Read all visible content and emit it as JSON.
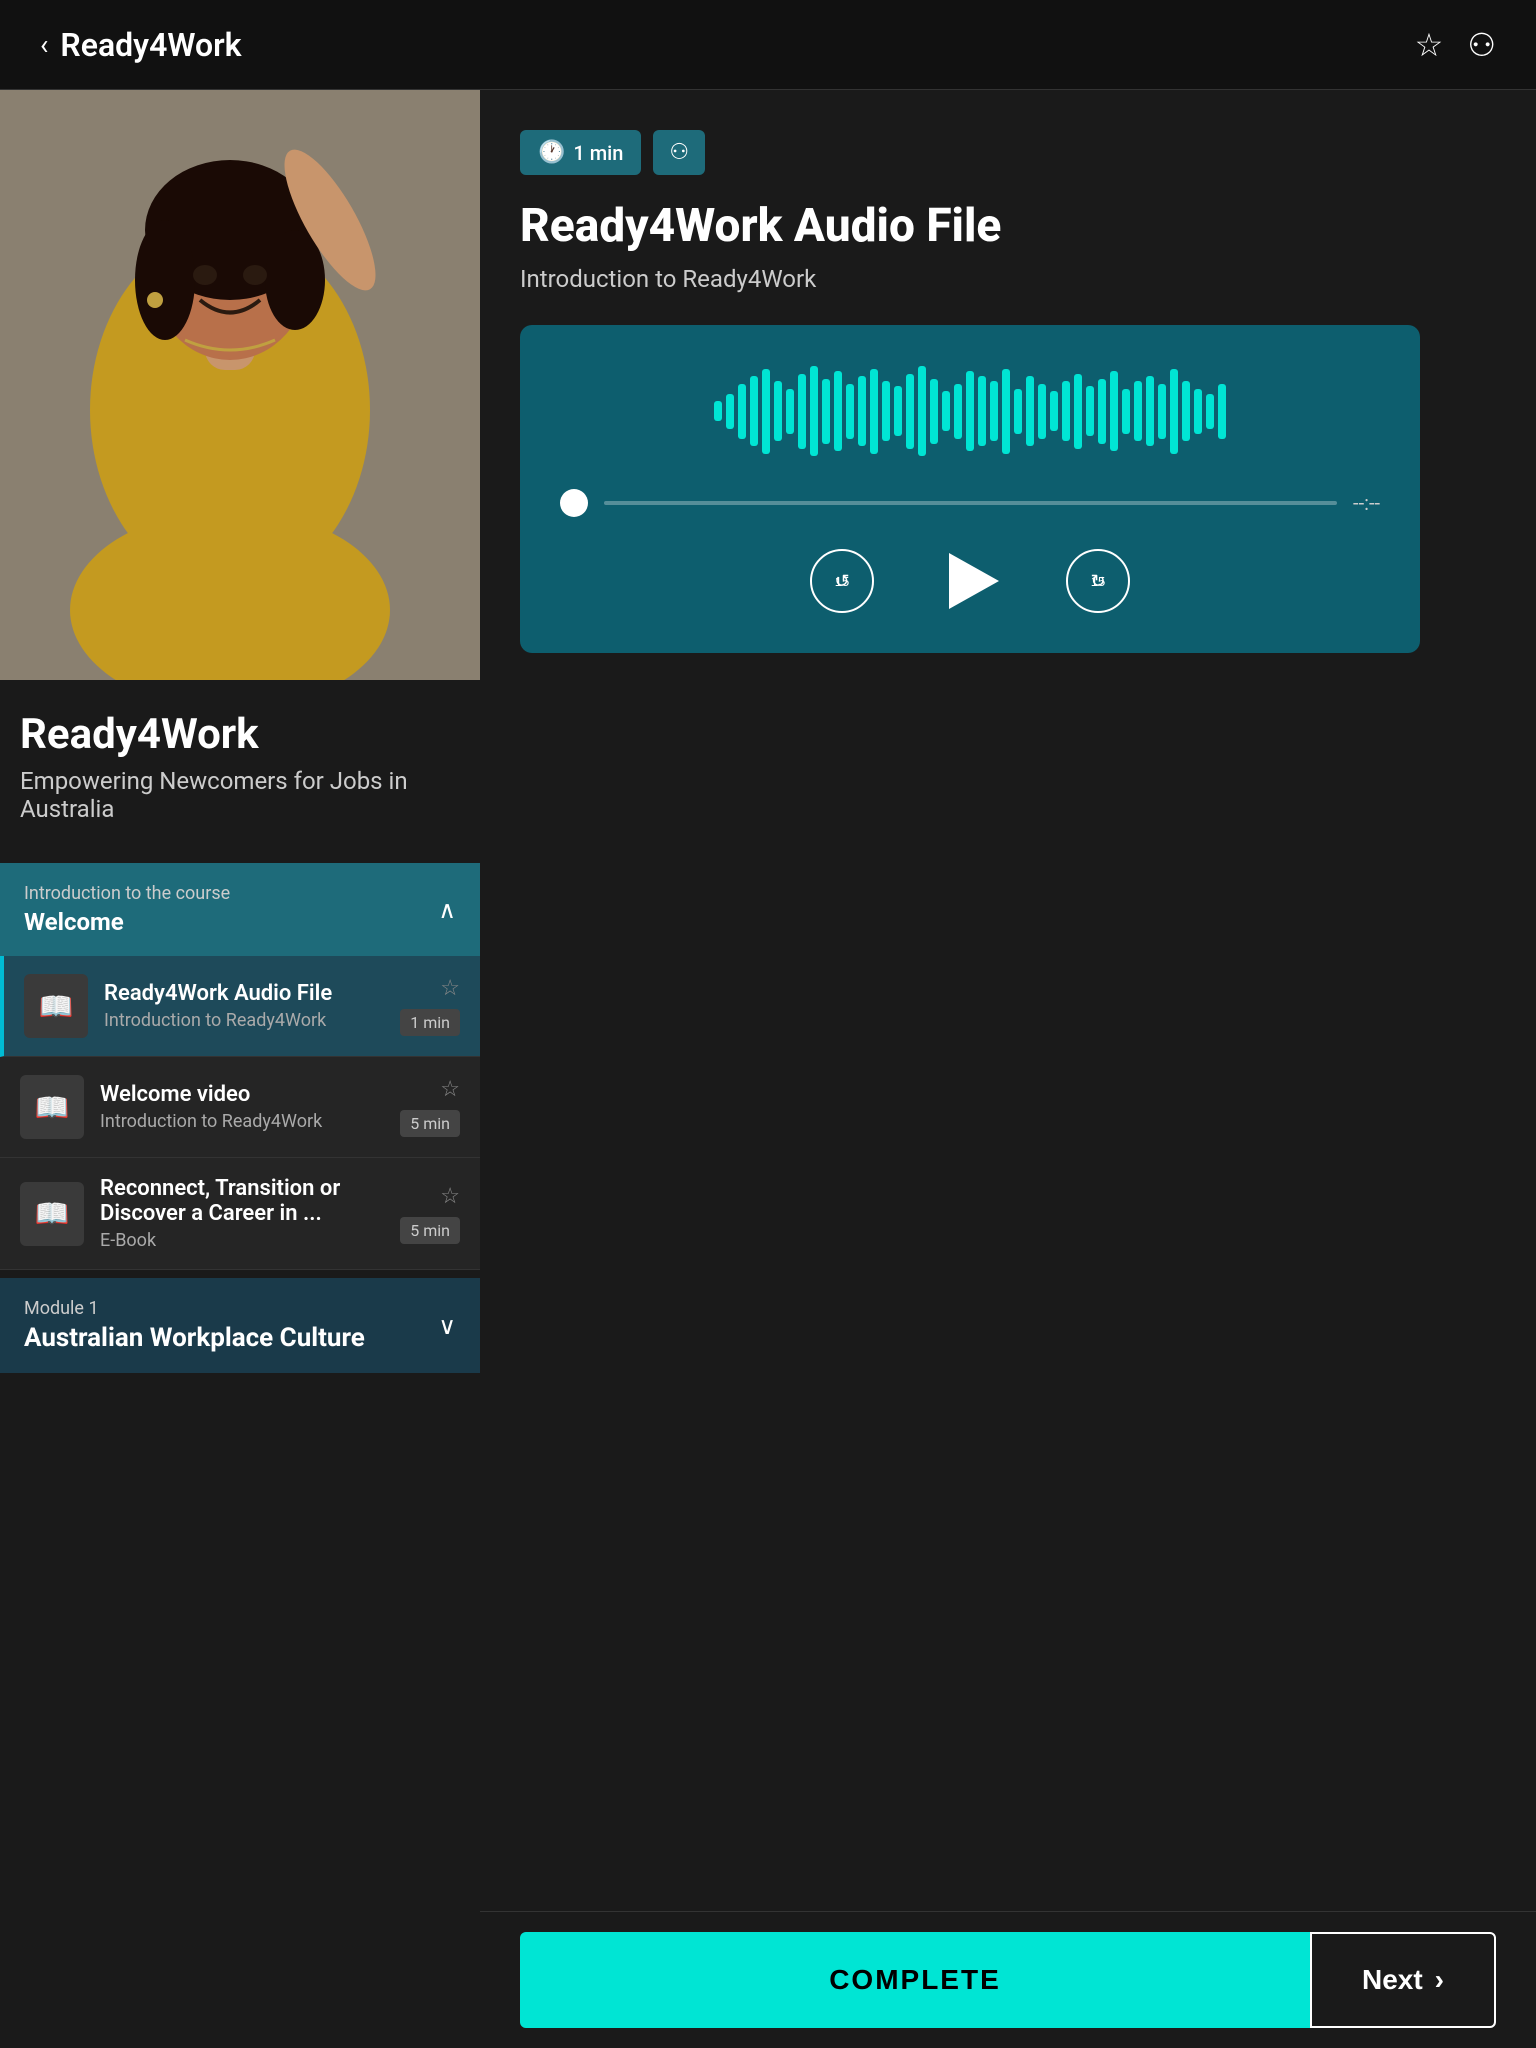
{
  "header": {
    "title": "Ready4Work",
    "back_label": "‹",
    "bookmark_icon": "☆",
    "link_icon": "⚇"
  },
  "hero": {
    "course_title": "Ready4Work",
    "course_subtitle": "Empowering Newcomers for Jobs in Australia"
  },
  "sidebar": {
    "section_label": "Introduction to the course",
    "section_title": "Welcome",
    "chevron_open": "∧",
    "lessons": [
      {
        "name": "Ready4Work Audio File",
        "sub": "Introduction to Ready4Work",
        "duration": "1 min",
        "active": true
      },
      {
        "name": "Welcome video",
        "sub": "Introduction to Ready4Work",
        "duration": "5 min",
        "active": false
      },
      {
        "name": "Reconnect, Transition or Discover a Career in ...",
        "sub": "E-Book",
        "duration": "5 min",
        "active": false
      }
    ],
    "module": {
      "label": "Module 1",
      "title": "Australian Workplace Culture",
      "chevron": "∨"
    }
  },
  "content": {
    "badge_time": "1 min",
    "badge_time_icon": "🕐",
    "badge_link_icon": "⚇",
    "title": "Ready4Work Audio File",
    "subtitle": "Introduction to Ready4Work",
    "audio": {
      "progress_time": "--:--",
      "rewind_label": "15",
      "forward_label": "15"
    }
  },
  "footer": {
    "complete_label": "COMPLETE",
    "next_label": "Next",
    "next_arrow": "›"
  },
  "waveform_heights": [
    20,
    35,
    55,
    70,
    85,
    60,
    45,
    75,
    90,
    65,
    80,
    55,
    70,
    85,
    60,
    50,
    75,
    90,
    65,
    40,
    55,
    80,
    70,
    60,
    85,
    45,
    70,
    55,
    40,
    60,
    75,
    50,
    65,
    80,
    45,
    60,
    70,
    55,
    85,
    60,
    45,
    35,
    55
  ]
}
